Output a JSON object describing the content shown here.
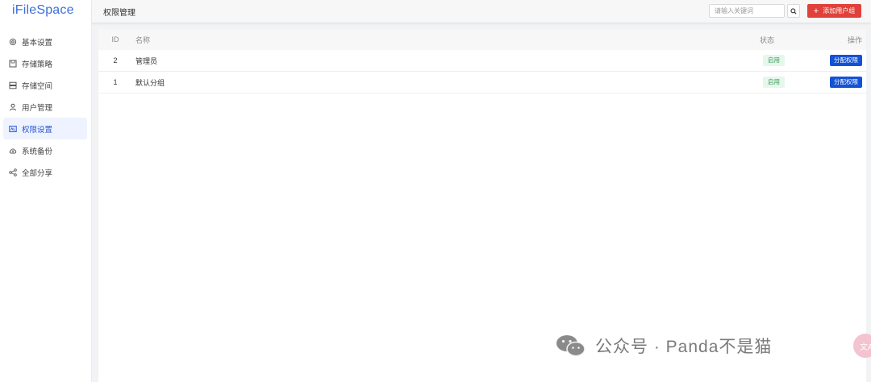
{
  "app": {
    "name": "iFileSpace"
  },
  "sidebar": {
    "items": [
      {
        "label": "基本设置",
        "icon": "gear-icon"
      },
      {
        "label": "存储策略",
        "icon": "save-icon"
      },
      {
        "label": "存储空间",
        "icon": "storage-icon"
      },
      {
        "label": "用户管理",
        "icon": "user-icon"
      },
      {
        "label": "权限设置",
        "icon": "permission-icon",
        "active": true
      },
      {
        "label": "系统备份",
        "icon": "cloud-upload-icon"
      },
      {
        "label": "全部分享",
        "icon": "share-icon"
      }
    ]
  },
  "header": {
    "title": "权限管理",
    "search_placeholder": "请输入关键词",
    "add_label": "添加用户组"
  },
  "table": {
    "columns": {
      "id": "ID",
      "name": "名称",
      "status": "状态",
      "actions": "操作"
    },
    "rows": [
      {
        "id": "2",
        "name": "管理员",
        "status": "启用",
        "action": "分配权限"
      },
      {
        "id": "1",
        "name": "默认分组",
        "status": "启用",
        "action": "分配权限"
      }
    ]
  },
  "watermark": {
    "text": "公众号 · Panda不是猫",
    "badge": "文A"
  },
  "colors": {
    "accent": "#1452d4",
    "danger": "#e0413a",
    "brand": "#3b6fd8",
    "success_bg": "#e6f7ec"
  }
}
